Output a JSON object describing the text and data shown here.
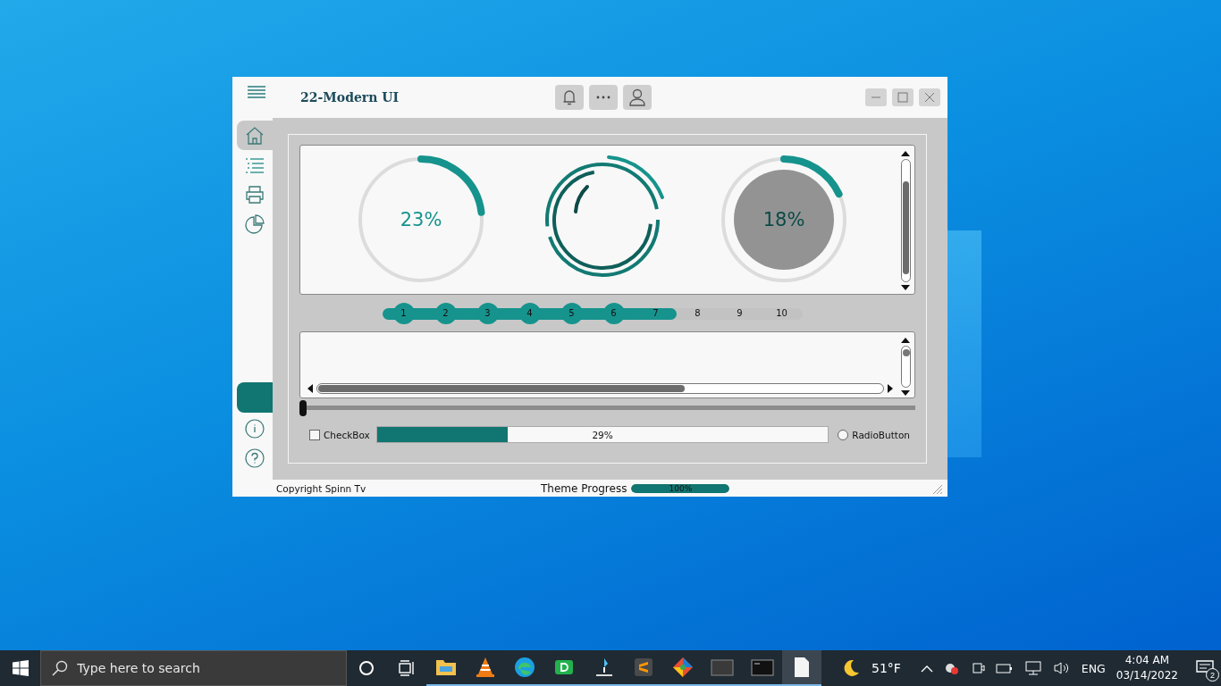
{
  "window": {
    "title": "22-Modern UI"
  },
  "sidebar": {
    "items": [
      {
        "kind": "home",
        "selected": true
      },
      {
        "kind": "list",
        "selected": false
      },
      {
        "kind": "print",
        "selected": false
      },
      {
        "kind": "chart",
        "selected": false
      }
    ],
    "bottom_items": [
      {
        "kind": "block",
        "selected": false
      },
      {
        "kind": "info",
        "selected": false
      },
      {
        "kind": "help",
        "selected": false
      }
    ]
  },
  "gauges": [
    {
      "kind": "ring",
      "level": 0.23,
      "reading": "23%"
    },
    {
      "kind": "spinner"
    },
    {
      "kind": "filled",
      "level": 0.18,
      "reading": "18%"
    }
  ],
  "steps": {
    "level": 0.7,
    "items": [
      {
        "label": "1",
        "done": true
      },
      {
        "label": "2",
        "done": true
      },
      {
        "label": "3",
        "done": true
      },
      {
        "label": "4",
        "done": true
      },
      {
        "label": "5",
        "done": true
      },
      {
        "label": "6",
        "done": true
      },
      {
        "label": "7",
        "done": false
      },
      {
        "label": "8",
        "done": false
      },
      {
        "label": "9",
        "done": false
      },
      {
        "label": "10",
        "done": false
      }
    ]
  },
  "slider": {
    "level": 0.0
  },
  "checkbox": {
    "label": "CheckBox",
    "checked": false
  },
  "progress": {
    "level": 0.29,
    "reading": "29%"
  },
  "radio": {
    "label": "RadioButton",
    "selected": false
  },
  "status_bar": {
    "copyright": "Copyright Spinn Tv",
    "theme_label": "Theme Progress",
    "level": 1.0,
    "reading": "100%"
  },
  "taskbar": {
    "search": {
      "placeholder": "Type here to search"
    },
    "apps": [
      {
        "kind": "folder",
        "selected": false
      },
      {
        "kind": "cone",
        "selected": false
      },
      {
        "kind": "browser",
        "selected": false
      },
      {
        "kind": "tile",
        "selected": false
      },
      {
        "kind": "tool",
        "selected": false
      },
      {
        "kind": "sublime",
        "selected": false
      },
      {
        "kind": "git",
        "selected": false
      },
      {
        "kind": "window",
        "selected": false
      },
      {
        "kind": "terminal",
        "selected": false
      },
      {
        "kind": "file",
        "selected": true
      }
    ],
    "weather": "51°F",
    "language": "ENG",
    "time": "4:04 AM",
    "date": "03/14/2022",
    "notifications": "2"
  }
}
